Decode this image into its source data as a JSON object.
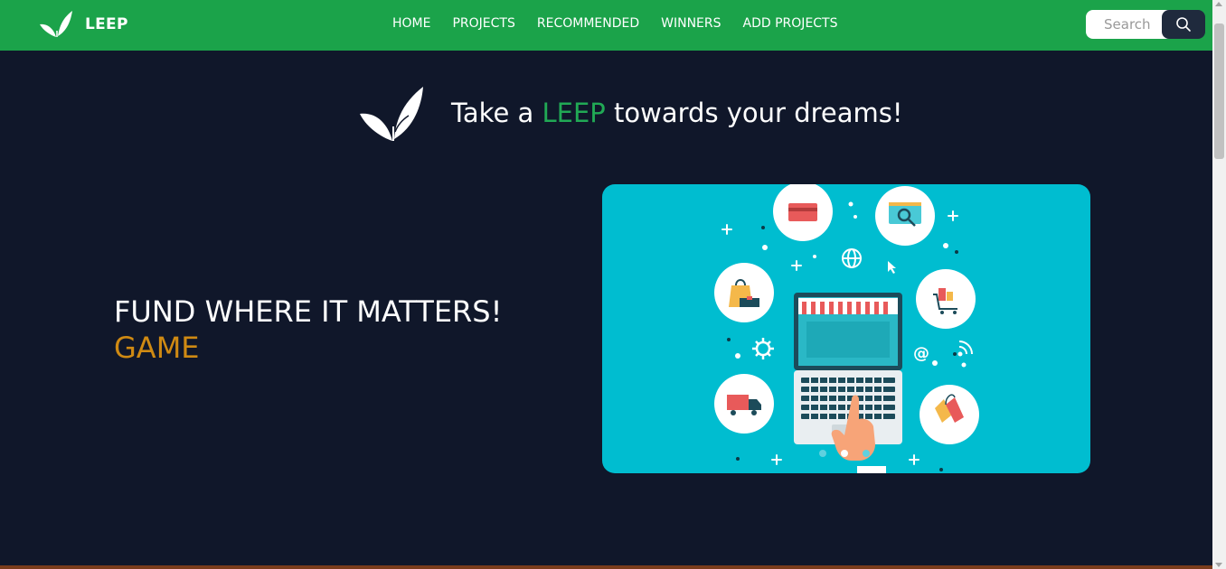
{
  "brand": {
    "name": "LEEP",
    "icon": "leaf-logo-icon"
  },
  "nav": {
    "items": [
      {
        "label": "HOME"
      },
      {
        "label": "PROJECTS"
      },
      {
        "label": "RECOMMENDED"
      },
      {
        "label": "WINNERS"
      },
      {
        "label": "ADD PROJECTS"
      }
    ]
  },
  "search": {
    "placeholder": "Search",
    "icon": "search-icon"
  },
  "hero": {
    "tagline_prefix": "Take a ",
    "tagline_accent": "LEEP",
    "tagline_suffix": " towards your dreams!",
    "headline": "FUND WHERE IT MATTERS!",
    "subheadline": "GAME"
  },
  "carousel": {
    "slide_count": 3,
    "active_index": 1,
    "slide_icons": [
      "credit-card-icon",
      "search-monitor-icon",
      "shopping-bag-icon",
      "shopping-cart-icon",
      "laptop-storefront-icon",
      "delivery-truck-icon",
      "price-tag-icon",
      "globe-icon",
      "gear-icon"
    ]
  },
  "colors": {
    "navbar": "#1ba34a",
    "background": "#10172a",
    "accent_green": "#21a955",
    "accent_orange": "#cf8a13",
    "carousel_bg": "#00bdd0",
    "search_button": "#1f2a3d"
  }
}
